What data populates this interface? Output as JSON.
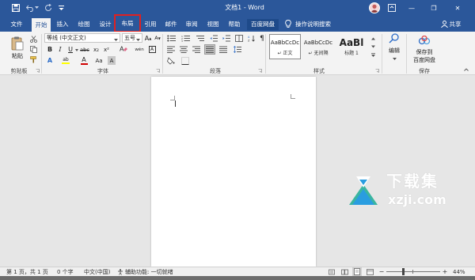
{
  "titlebar": {
    "title": "文档1 - Word",
    "minimize_label": "—",
    "restore_label": "❐",
    "close_label": "✕"
  },
  "tabs": [
    {
      "label": "文件"
    },
    {
      "label": "开始"
    },
    {
      "label": "插入"
    },
    {
      "label": "绘图"
    },
    {
      "label": "设计"
    },
    {
      "label": "布局"
    },
    {
      "label": "引用"
    },
    {
      "label": "邮件"
    },
    {
      "label": "审阅"
    },
    {
      "label": "视图"
    },
    {
      "label": "帮助"
    },
    {
      "label": "百度网盘"
    }
  ],
  "tell_me": "操作说明搜索",
  "share_label": "共享",
  "ribbon": {
    "clipboard": {
      "label": "剪贴板",
      "paste": "粘贴"
    },
    "font": {
      "label": "字体",
      "font_name": "等线 (中文正文)",
      "font_size": "五号",
      "bold": "B",
      "italic": "I",
      "underline": "U",
      "strike": "abc",
      "subscript": "x₂",
      "superscript": "x²",
      "font_color": "A",
      "highlight": "ab",
      "grow": "A",
      "shrink": "A",
      "case": "Aa",
      "wen": "wén",
      "char_border": "A"
    },
    "paragraph": {
      "label": "段落"
    },
    "styles": {
      "label": "样式",
      "items": [
        {
          "preview": "AaBbCcDc",
          "name": "↵ 正文"
        },
        {
          "preview": "AaBbCcDc",
          "name": "↵ 无间隔"
        },
        {
          "preview": "AaBl",
          "name": "标题 1"
        }
      ]
    },
    "editing": {
      "label": "编辑"
    },
    "save": {
      "label": "保存",
      "button_line1": "保存到",
      "button_line2": "百度网盘"
    }
  },
  "watermark": {
    "title": "下载集",
    "domain": "xzji.com"
  },
  "status": {
    "page": "第 1 页，共 1 页",
    "words": "0 个字",
    "language": "中文(中国)",
    "accessibility": "辅助功能: 一切就绪",
    "zoom_minus": "−",
    "zoom_plus": "+",
    "zoom": "44%"
  },
  "colors": {
    "word_blue": "#2b579a",
    "highlight_red": "#e02020",
    "font_color_red": "#d00000",
    "highlight_yellow": "#ffff00"
  }
}
